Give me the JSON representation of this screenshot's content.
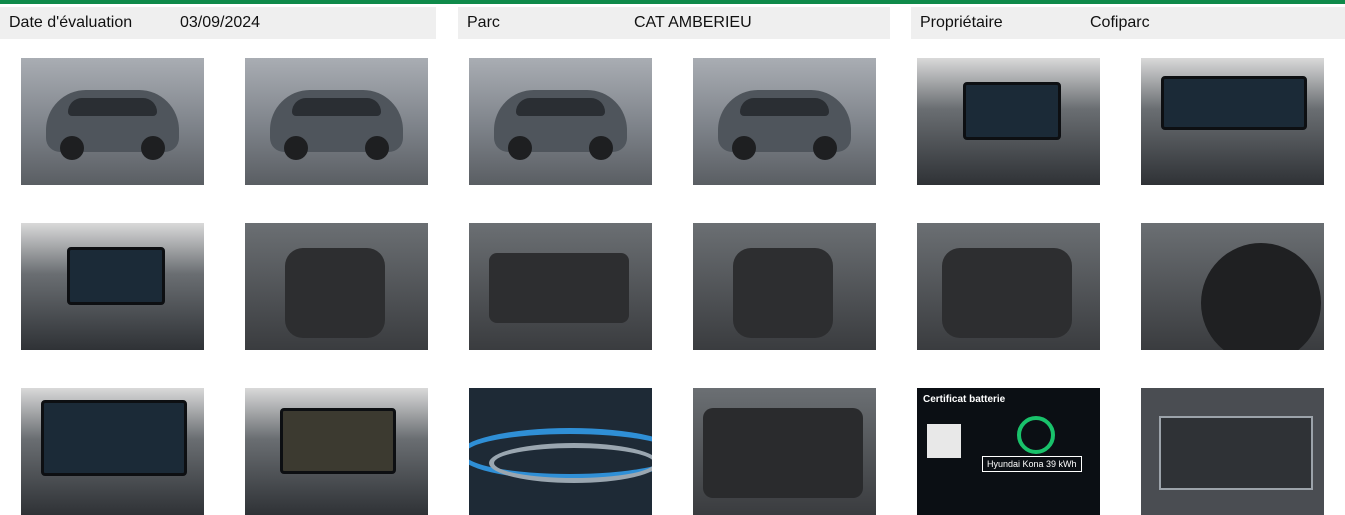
{
  "header": {
    "evaluation_date": {
      "label": "Date d'évaluation",
      "value": "03/09/2024"
    },
    "park": {
      "label": "Parc",
      "value": "CAT AMBERIEU"
    },
    "owner": {
      "label": "Propriétaire",
      "value": "Cofiparc"
    }
  },
  "certificate": {
    "title": "Certificat batterie",
    "model": "Hyundai Kona 39 kWh"
  },
  "colors": {
    "accent_green": "#0f8a4a",
    "header_bg": "#efefef"
  }
}
